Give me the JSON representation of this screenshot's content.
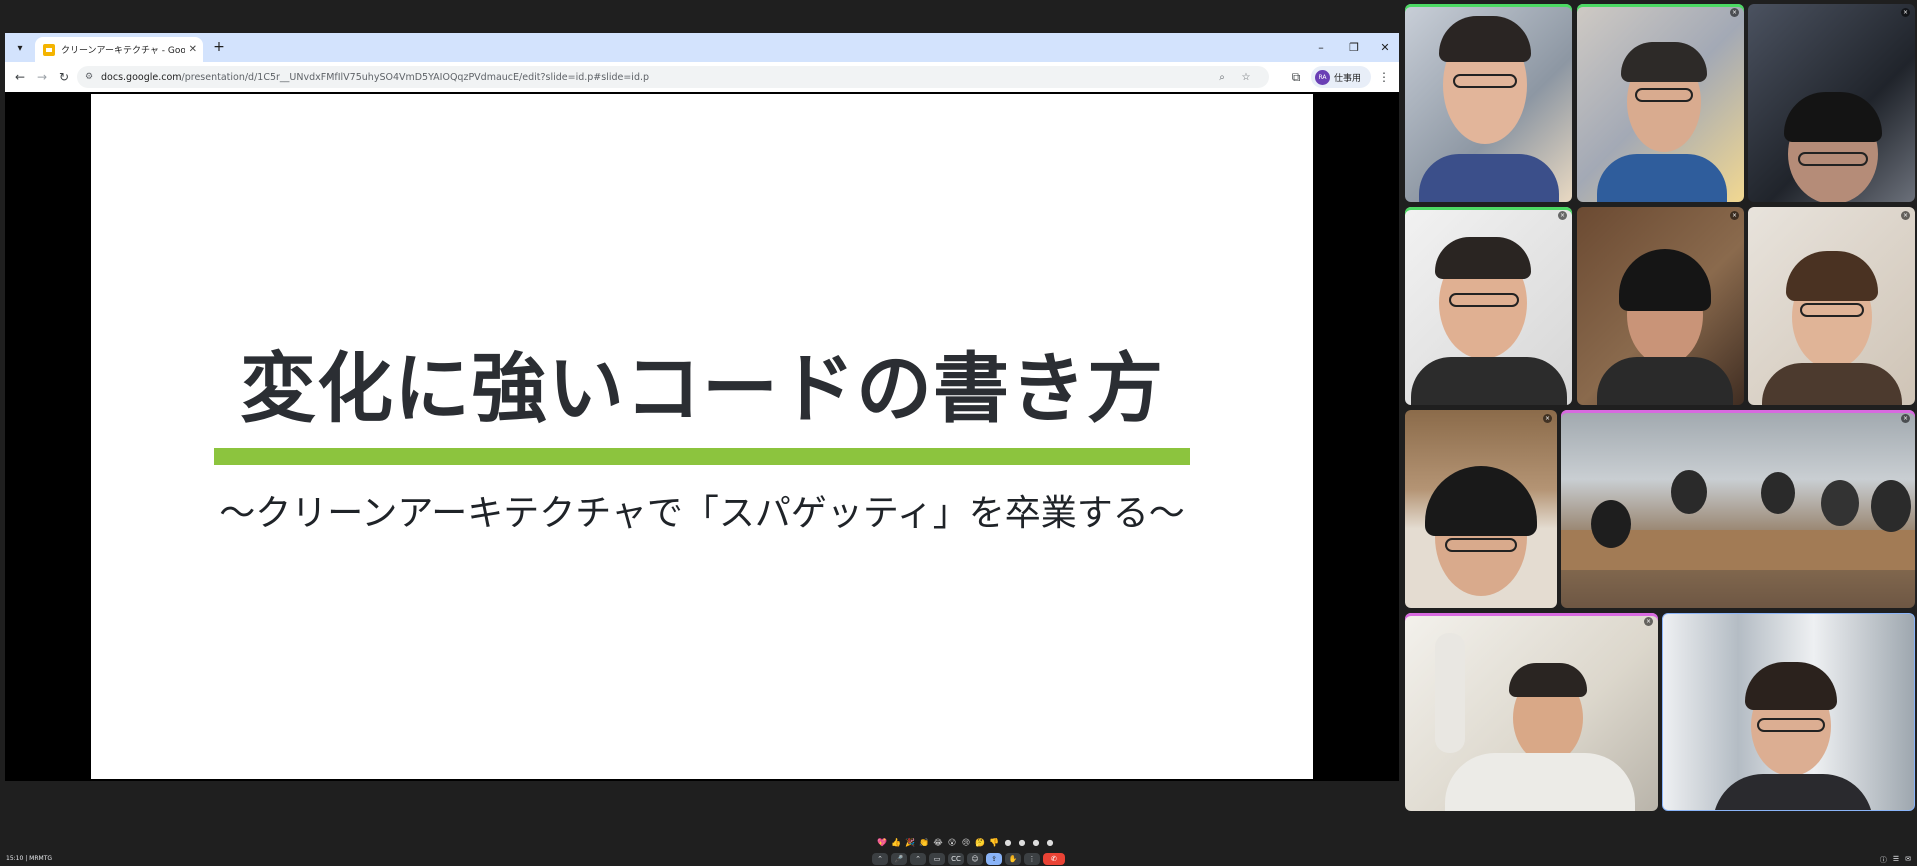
{
  "browser": {
    "tab_title": "クリーンアーキテクチャ - Google ス",
    "url_host": "docs.google.com",
    "url_path": "/presentation/d/1C5r__UNvdxFMfIlV75uhySO4VmD5YAIOQqzPVdmaucE/edit?slide=id.p#slide=id.p",
    "profile_label": "仕事用",
    "profile_initials": "RA"
  },
  "slide": {
    "title": "変化に強いコードの書き方",
    "subtitle": "〜クリーンアーキテクチャで「スパゲッティ」を卒業する〜",
    "accent_color": "#8cc43e"
  },
  "meeting": {
    "time": "15:10",
    "separator": "|",
    "code": "MRMTG"
  },
  "reactions": [
    "💖",
    "👍",
    "🎉",
    "👏",
    "😂",
    "😮",
    "😢",
    "🤔",
    "👎",
    "●",
    "●",
    "●",
    "●"
  ],
  "controls": [
    {
      "icon": "more",
      "label": "⌃"
    },
    {
      "icon": "mic",
      "label": "🎤"
    },
    {
      "icon": "more",
      "label": "⌃"
    },
    {
      "icon": "camera",
      "label": "▭"
    },
    {
      "icon": "captions",
      "label": "CC"
    },
    {
      "icon": "emoji",
      "label": "☺"
    },
    {
      "icon": "present",
      "label": "⇪"
    },
    {
      "icon": "raise-hand",
      "label": "✋"
    },
    {
      "icon": "more-options",
      "label": "⋮"
    },
    {
      "icon": "leave-call",
      "label": "✆"
    }
  ]
}
